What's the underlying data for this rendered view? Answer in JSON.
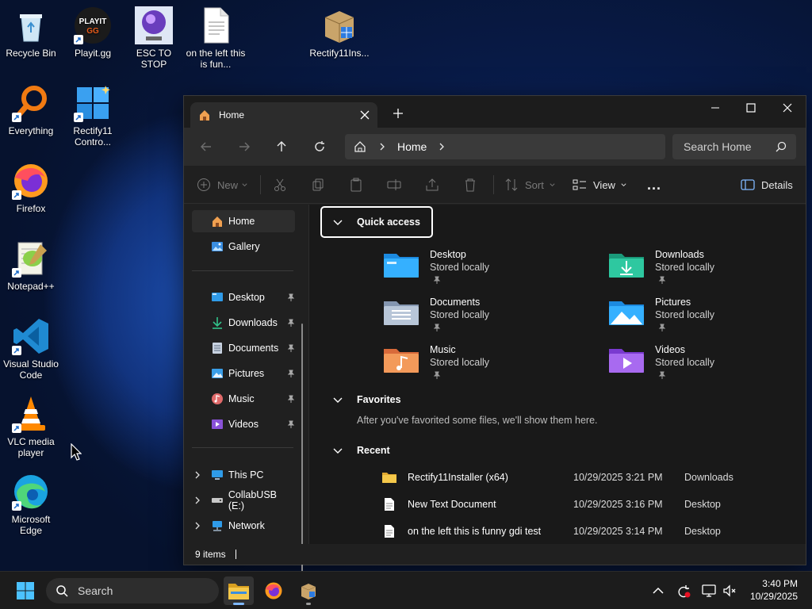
{
  "desktop": {
    "icons": [
      {
        "label": "Recycle Bin"
      },
      {
        "label": "Playit.gg"
      },
      {
        "label": "ESC TO STOP"
      },
      {
        "label": "on the left this is fun..."
      },
      {
        "label": "Rectify11Ins..."
      },
      {
        "label": "Everything"
      },
      {
        "label": "Rectify11 Contro..."
      },
      {
        "label": "Firefox"
      },
      {
        "label": "Notepad++"
      },
      {
        "label": "Visual Studio Code"
      },
      {
        "label": "VLC media player"
      },
      {
        "label": "Microsoft Edge"
      }
    ]
  },
  "window": {
    "tab_title": "Home",
    "breadcrumb": [
      "Home"
    ],
    "search_placeholder": "Search Home",
    "toolbar": {
      "new_label": "New",
      "sort_label": "Sort",
      "view_label": "View",
      "more_label": "...",
      "details_label": "Details"
    },
    "sidebar": {
      "top": [
        {
          "label": "Home",
          "icon": "home-icon",
          "active": true
        },
        {
          "label": "Gallery",
          "icon": "gallery-icon"
        }
      ],
      "pinned": [
        {
          "label": "Desktop",
          "icon": "desktop-folder-icon"
        },
        {
          "label": "Downloads",
          "icon": "downloads-folder-icon"
        },
        {
          "label": "Documents",
          "icon": "documents-folder-icon"
        },
        {
          "label": "Pictures",
          "icon": "pictures-folder-icon"
        },
        {
          "label": "Music",
          "icon": "music-folder-icon"
        },
        {
          "label": "Videos",
          "icon": "videos-folder-icon"
        }
      ],
      "drives": [
        {
          "label": "This PC",
          "icon": "pc-icon"
        },
        {
          "label": "CollabUSB (E:)",
          "icon": "usb-drive-icon"
        },
        {
          "label": "Network",
          "icon": "network-icon"
        }
      ]
    },
    "quick_access": {
      "heading": "Quick access",
      "folders": [
        {
          "name": "Desktop",
          "status": "Stored locally"
        },
        {
          "name": "Downloads",
          "status": "Stored locally"
        },
        {
          "name": "Documents",
          "status": "Stored locally"
        },
        {
          "name": "Pictures",
          "status": "Stored locally"
        },
        {
          "name": "Music",
          "status": "Stored locally"
        },
        {
          "name": "Videos",
          "status": "Stored locally"
        }
      ]
    },
    "favorites": {
      "heading": "Favorites",
      "empty_text": "After you've favorited some files, we'll show them here."
    },
    "recent": {
      "heading": "Recent",
      "items": [
        {
          "name": "Rectify11Installer (x64)",
          "date": "10/29/2025 3:21 PM",
          "location": "Downloads",
          "type": "folder"
        },
        {
          "name": "New Text Document",
          "date": "10/29/2025 3:16 PM",
          "location": "Desktop",
          "type": "file"
        },
        {
          "name": "on the left this is funny gdi test",
          "date": "10/29/2025 3:14 PM",
          "location": "Desktop",
          "type": "file"
        }
      ]
    },
    "status": "9 items"
  },
  "taskbar": {
    "search_placeholder": "Search",
    "time": "3:40 PM",
    "date": "10/29/2025"
  }
}
